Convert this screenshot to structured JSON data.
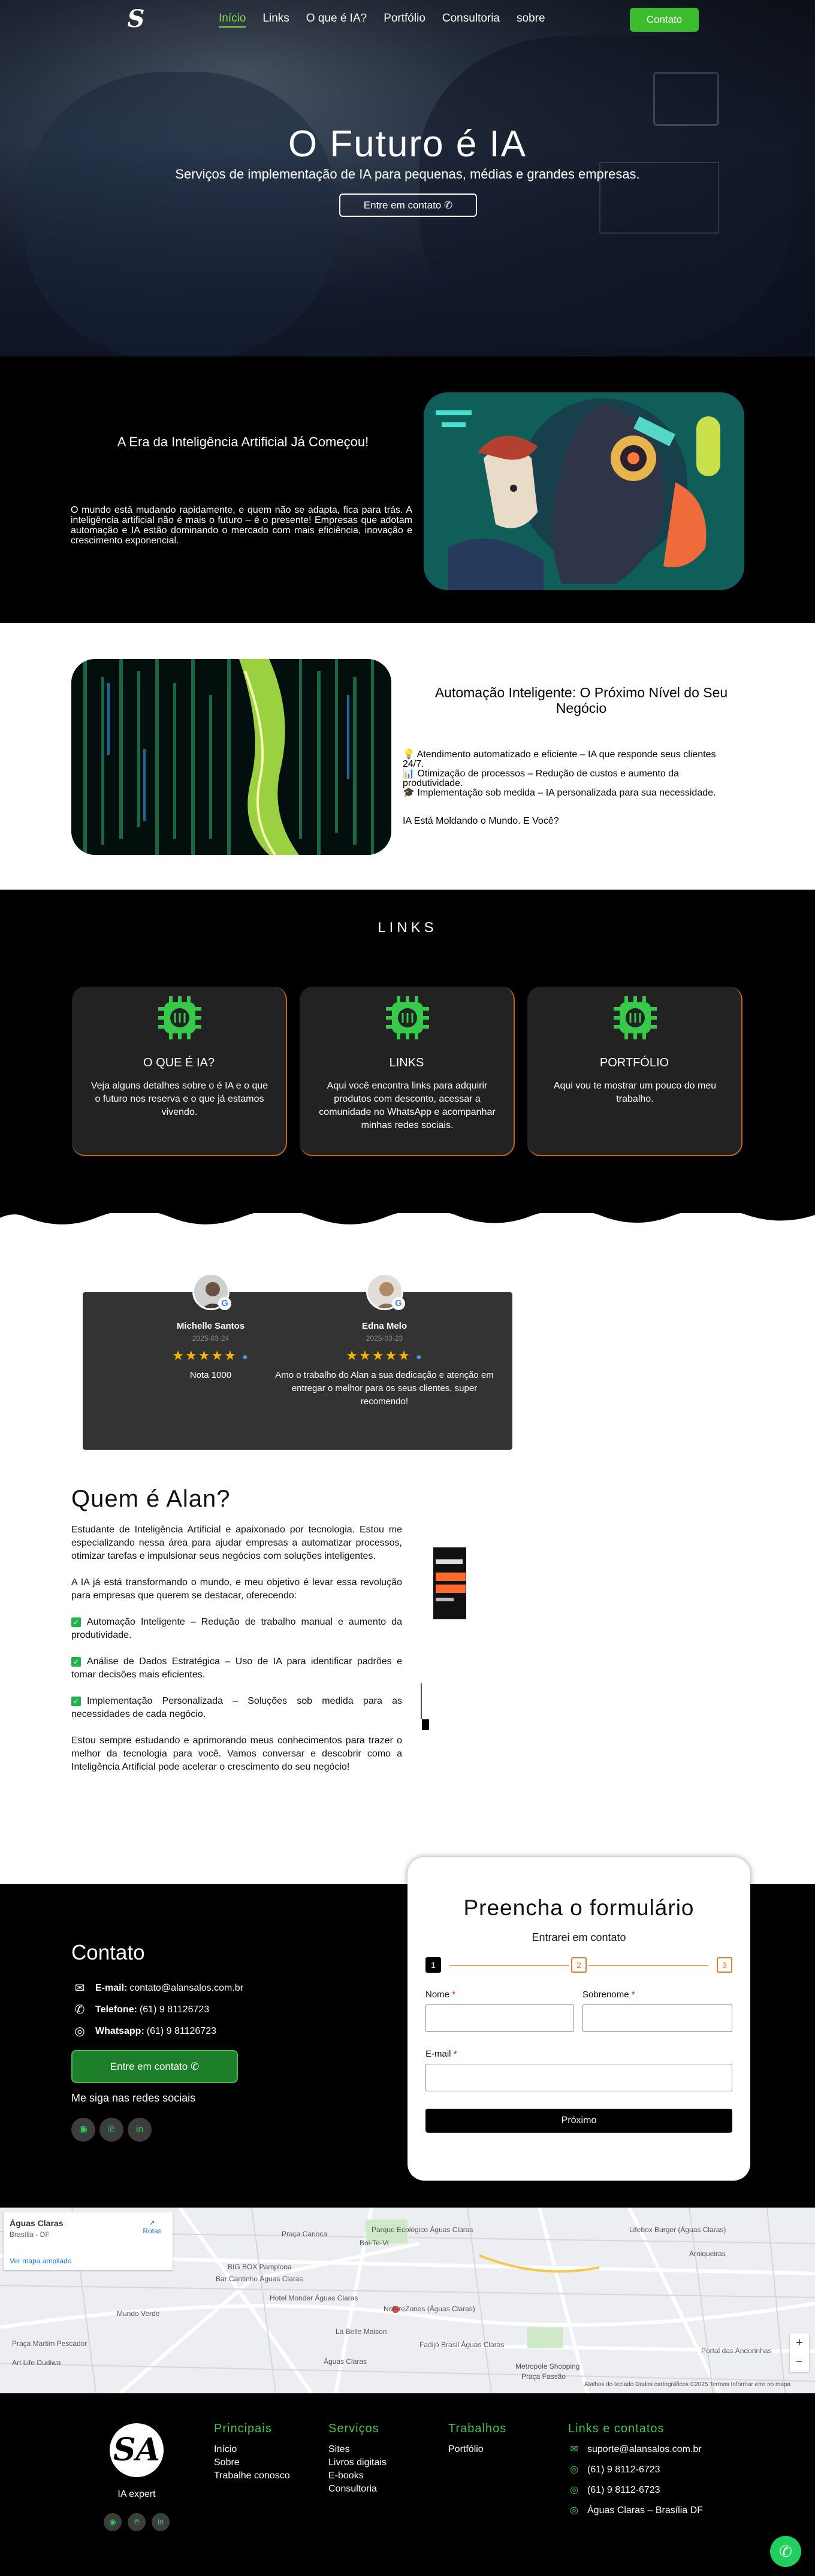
{
  "nav": {
    "logo": "S",
    "links": [
      "Início",
      "Links",
      "O que é IA?",
      "Portfólio",
      "Consultoria",
      "sobre"
    ],
    "contact_button": "Contato"
  },
  "hero": {
    "title": "O Futuro é IA",
    "subtitle": "Serviços de implementação de IA para pequenas, médias e grandes empresas.",
    "button": "Entre em contato ✆"
  },
  "era": {
    "title": "A Era da Inteligência Artificial Já Começou!",
    "text": "O mundo está mudando rapidamente, e quem não se adapta, fica para trás. A inteligência artificial não é mais o futuro – é o presente! Empresas que adotam automação e IA estão dominando o mercado com mais eficiência, inovação e crescimento exponencial."
  },
  "automacao": {
    "title": "Automação Inteligente: O Próximo Nível do Seu Negócio",
    "items": [
      "💡 Atendimento automatizado e eficiente – IA que responde seus clientes 24/7.",
      "📊 Otimização de processos – Redução de custos e aumento da produtividade.",
      "🎓 Implementação sob medida – IA personalizada para sua necessidade."
    ],
    "question": "IA Está Moldando o Mundo. E Você?"
  },
  "links": {
    "title": "LINKS",
    "cards": [
      {
        "title": "O QUE É IA?",
        "text": "Veja alguns detalhes sobre o é IA e o que o futuro nos reserva e o que já estamos vivendo."
      },
      {
        "title": "LINKS",
        "text": "Aqui você encontra links para adquirir produtos com desconto, acessar a comunidade no WhatsApp e acompanhar minhas redes sociais."
      },
      {
        "title": "PORTFÓLIO",
        "text": "Aqui vou te mostrar um pouco do meu trabalho."
      }
    ]
  },
  "reviews": [
    {
      "name": "Michelle Santos",
      "date": "2025-03-24",
      "stars": "★★★★★",
      "text": "Nota 1000"
    },
    {
      "name": "Edna Melo",
      "date": "2025-03-23",
      "stars": "★★★★★",
      "text": "Amo o trabalho do Alan a sua dedicação e atenção em entregar o melhor para os seus clientes, super recomendo!"
    }
  ],
  "quem": {
    "title": "Quem é Alan?",
    "p1": "Estudante de Inteligência Artificial e apaixonado por tecnologia. Estou me especializando nessa área para ajudar empresas a automatizar processos, otimizar tarefas e impulsionar seus negócios com soluções inteligentes.",
    "p2": "A IA já está transformando o mundo, e meu objetivo é levar essa revolução para empresas que querem se destacar, oferecendo:",
    "items": [
      "Automação Inteligente – Redução de trabalho manual e aumento da produtividade.",
      "Análise de Dados Estratégica – Uso de IA para identificar padrões e tomar decisões mais eficientes.",
      "Implementação Personalizada – Soluções sob medida para as necessidades de cada negócio."
    ],
    "p3": "Estou sempre estudando e aprimorando meus conhecimentos para trazer o melhor da tecnologia para você. Vamos conversar e descobrir como a Inteligência Artificial pode acelerar o crescimento do seu negócio!"
  },
  "contato": {
    "title": "Contato",
    "email_label": "E-mail:",
    "email": "contato@alansalos.com.br",
    "phone_label": "Telefone:",
    "phone": "(61) 9 81126723",
    "whats_label": "Whatsapp:",
    "whats": "(61) 9 81126723",
    "button": "Entre em contato ✆",
    "social_title": "Me siga nas redes sociais"
  },
  "form": {
    "title": "Preencha o formulário",
    "subtitle": "Entrarei em contato",
    "steps": [
      "1",
      "2",
      "3"
    ],
    "nome": "Nome",
    "sobrenome": "Sobrenome",
    "email": "E-mail",
    "required": "*",
    "submit": "Próximo"
  },
  "map": {
    "place": "Águas Claras",
    "address": "Brasília - DF",
    "directions": "Rotas",
    "larger": "Ver mapa ampliado",
    "labels": [
      "Praça Carioca",
      "Parque Ecológico Águas Claras",
      "Lifebox Burger (Águas Claras)",
      "BIG BOX Pamplona",
      "Bar Cantinho Águas Claras",
      "Hotel Monder Águas Claras",
      "Mundo Verde",
      "NoFireZones (Águas Claras)",
      "Praça Martim Pescador",
      "Art Life Dudiwa",
      "La Belle Maison",
      "Fadijó Brasil Águas Claras",
      "Metropole Shopping",
      "Praça Fassão",
      "Portal das Andorinhas",
      "Arniqueiras",
      "Águas Claras",
      "Boi-Te-Vi"
    ],
    "footer": "Atalhos do teclado   Dados cartográficos ©2025   Termos   Informar erro no mapa"
  },
  "footer": {
    "logo": "SA",
    "name": "IA expert",
    "principais": {
      "title": "Principais",
      "items": [
        "Início",
        "Sobre",
        "Trabalhe conosco"
      ]
    },
    "servicos": {
      "title": "Serviços",
      "items": [
        "Sites",
        "Livros digitais",
        "E-books",
        "Consultoria"
      ]
    },
    "trabalhos": {
      "title": "Trabalhos",
      "items": [
        "Portfólio"
      ]
    },
    "links_contatos": {
      "title": "Links e contatos",
      "items": [
        "suporte@alansalos.com.br",
        "(61) 9 8112-6723",
        "(61) 9 8112-6723",
        "Águas Claras – Brasília DF"
      ]
    }
  }
}
